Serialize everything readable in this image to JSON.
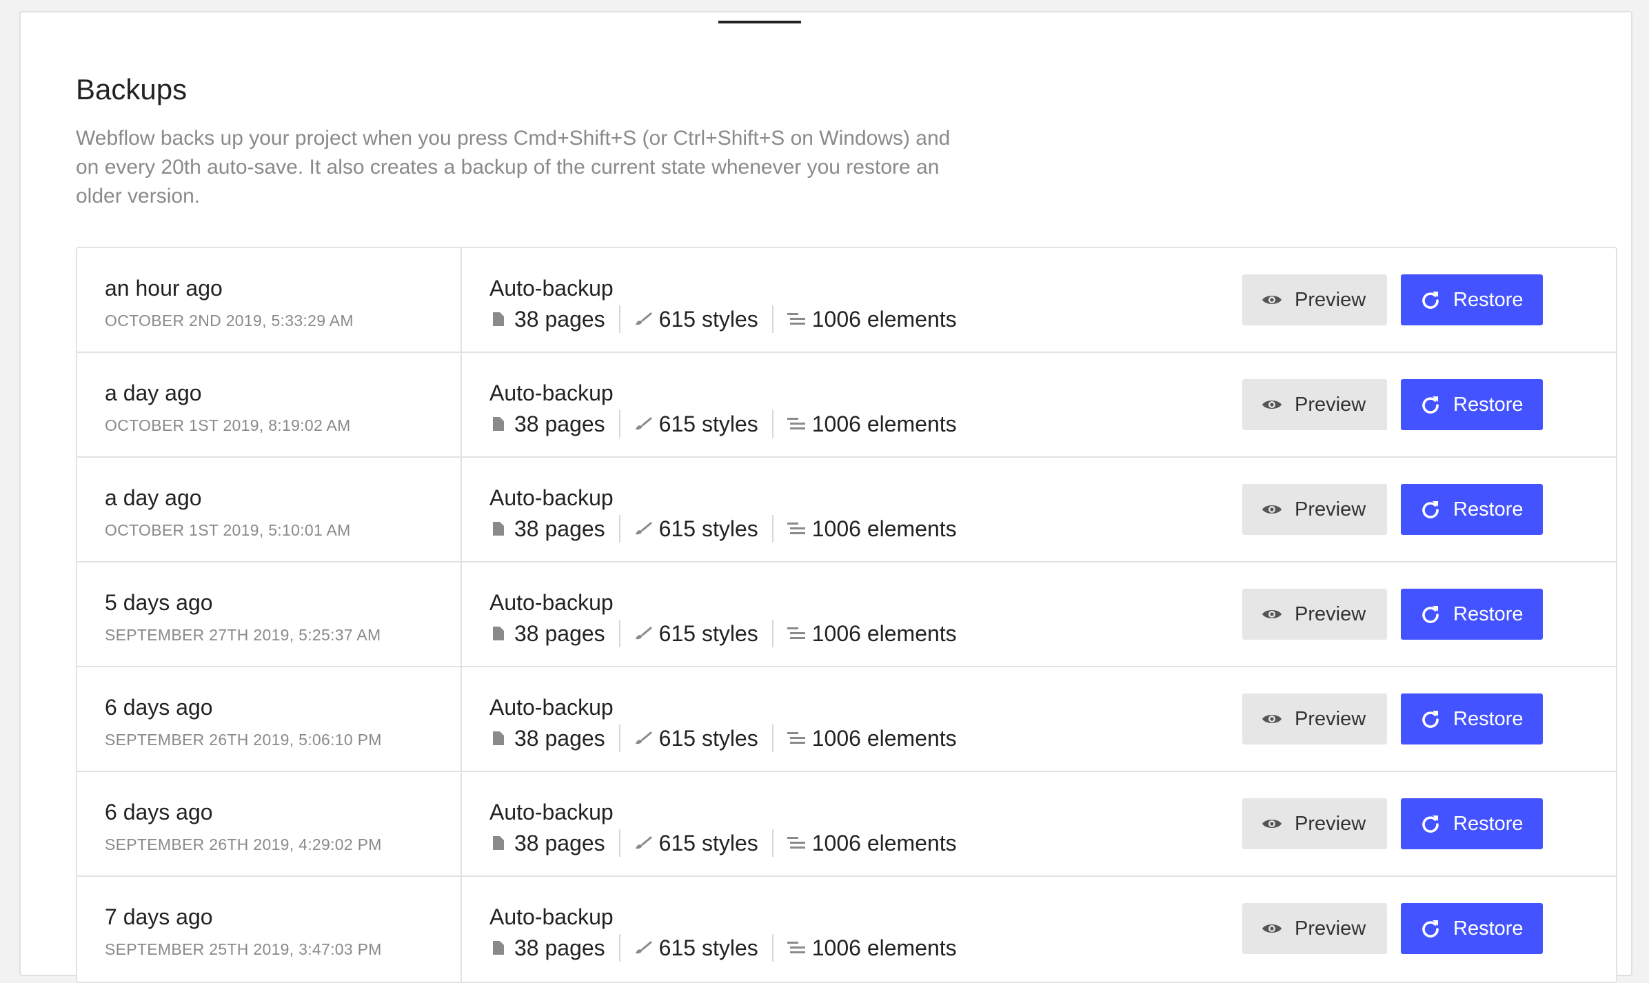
{
  "page": {
    "title": "Backups",
    "description": "Webflow backs up your project when you press Cmd+Shift+S (or Ctrl+Shift+S on Windows) and on every 20th auto-save. It also creates a backup of the current state whenever you restore an older version."
  },
  "colors": {
    "accent": "#4353ff",
    "preview_bg": "#e6e6e6",
    "muted_text": "#8a8a8a"
  },
  "icons": {
    "pages": "file-icon",
    "styles": "brush-icon",
    "elements": "elements-icon",
    "preview": "eye-icon",
    "restore": "restore-icon"
  },
  "backups": [
    {
      "relative": "an hour ago",
      "timestamp": "OCTOBER 2ND 2019, 5:33:29 AM",
      "kind": "Auto-backup",
      "pages": "38 pages",
      "styles": "615 styles",
      "elements": "1006 elements",
      "preview_label": "Preview",
      "restore_label": "Restore"
    },
    {
      "relative": "a day ago",
      "timestamp": "OCTOBER 1ST 2019, 8:19:02 AM",
      "kind": "Auto-backup",
      "pages": "38 pages",
      "styles": "615 styles",
      "elements": "1006 elements",
      "preview_label": "Preview",
      "restore_label": "Restore"
    },
    {
      "relative": "a day ago",
      "timestamp": "OCTOBER 1ST 2019, 5:10:01 AM",
      "kind": "Auto-backup",
      "pages": "38 pages",
      "styles": "615 styles",
      "elements": "1006 elements",
      "preview_label": "Preview",
      "restore_label": "Restore"
    },
    {
      "relative": "5 days ago",
      "timestamp": "SEPTEMBER 27TH 2019, 5:25:37 AM",
      "kind": "Auto-backup",
      "pages": "38 pages",
      "styles": "615 styles",
      "elements": "1006 elements",
      "preview_label": "Preview",
      "restore_label": "Restore"
    },
    {
      "relative": "6 days ago",
      "timestamp": "SEPTEMBER 26TH 2019, 5:06:10 PM",
      "kind": "Auto-backup",
      "pages": "38 pages",
      "styles": "615 styles",
      "elements": "1006 elements",
      "preview_label": "Preview",
      "restore_label": "Restore"
    },
    {
      "relative": "6 days ago",
      "timestamp": "SEPTEMBER 26TH 2019, 4:29:02 PM",
      "kind": "Auto-backup",
      "pages": "38 pages",
      "styles": "615 styles",
      "elements": "1006 elements",
      "preview_label": "Preview",
      "restore_label": "Restore"
    },
    {
      "relative": "7 days ago",
      "timestamp": "SEPTEMBER 25TH 2019, 3:47:03 PM",
      "kind": "Auto-backup",
      "pages": "38 pages",
      "styles": "615 styles",
      "elements": "1006 elements",
      "preview_label": "Preview",
      "restore_label": "Restore"
    }
  ]
}
